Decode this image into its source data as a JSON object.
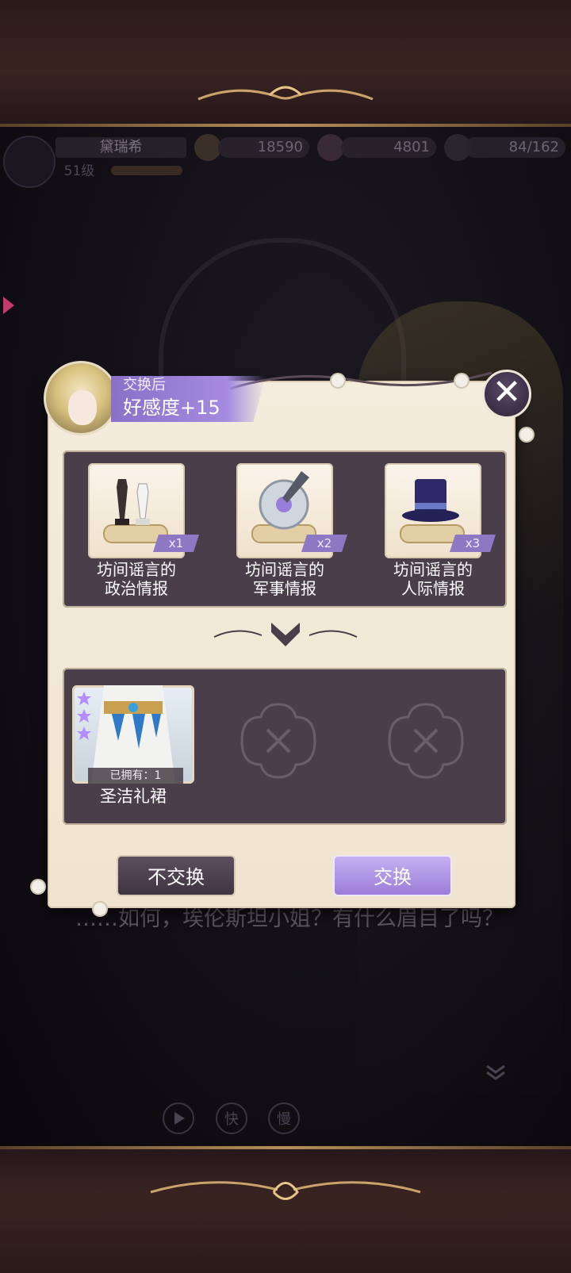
{
  "hud": {
    "player_name": "黛瑞希",
    "level": "51级",
    "gold": "18590",
    "gems": "4801",
    "stamina": "84/162"
  },
  "dialogue": {
    "text": "……如何，埃伦斯坦小姐？有什么眉目了吗？"
  },
  "controls": {
    "auto_label": "",
    "fast_label": "快",
    "slow_label": "慢"
  },
  "exchange": {
    "banner_subtitle": "交换后",
    "banner_main": "好感度+15",
    "items": [
      {
        "name_line1": "坊间谣言的",
        "name_line2": "政治情报",
        "qty": "x1",
        "icon": "chess-pieces-scroll-icon"
      },
      {
        "name_line1": "坊间谣言的",
        "name_line2": "军事情报",
        "qty": "x2",
        "icon": "shield-sword-scroll-icon"
      },
      {
        "name_line1": "坊间谣言的",
        "name_line2": "人际情报",
        "qty": "x3",
        "icon": "top-hat-scroll-icon"
      }
    ],
    "reward": {
      "name": "圣洁礼裙",
      "owned": "已拥有：1",
      "stars": 3
    },
    "cancel_label": "不交换",
    "confirm_label": "交换"
  },
  "colors": {
    "accent_purple": "#9a7dd8",
    "panel_dark": "#4a3e4a",
    "parchment": "#f4ecdc"
  }
}
